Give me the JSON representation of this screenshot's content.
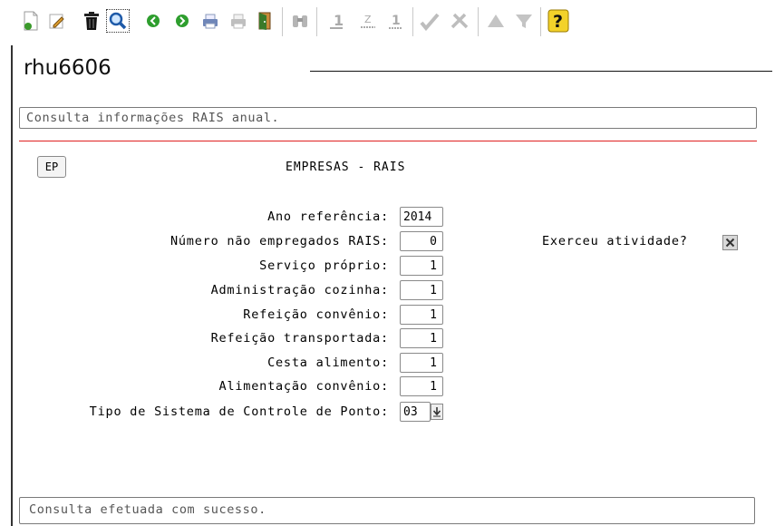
{
  "toolbar": {
    "buttons": [
      {
        "name": "new-document-icon"
      },
      {
        "name": "edit-pencil-icon"
      },
      {
        "name": "trash-icon"
      },
      {
        "name": "search-magnifier-icon"
      },
      {
        "name": "previous-record-icon"
      },
      {
        "name": "next-record-icon"
      },
      {
        "name": "print-icon"
      },
      {
        "name": "print-disabled-icon"
      },
      {
        "name": "exit-door-icon"
      },
      {
        "name": "binoculars-icon"
      },
      {
        "name": "first-record-icon"
      },
      {
        "name": "last-record-icon"
      },
      {
        "name": "confirm-check-icon"
      },
      {
        "name": "cancel-tools-icon"
      },
      {
        "name": "up-icon"
      },
      {
        "name": "filter-icon"
      },
      {
        "name": "help-question-icon"
      }
    ]
  },
  "program": {
    "name": "rhu6606",
    "description": "Consulta informações RAIS anual."
  },
  "frame": {
    "tag": "EP",
    "title": "EMPRESAS - RAIS"
  },
  "form": {
    "ano_referencia": {
      "label": "Ano referência:",
      "value": "2014"
    },
    "num_nao_empregados": {
      "label": "Número não empregados RAIS:",
      "value": "0"
    },
    "servico_proprio": {
      "label": "Serviço próprio:",
      "value": "1"
    },
    "administracao_cozinha": {
      "label": "Administração cozinha:",
      "value": "1"
    },
    "refeicao_convenio": {
      "label": "Refeição convênio:",
      "value": "1"
    },
    "refeicao_transportada": {
      "label": "Refeição transportada:",
      "value": "1"
    },
    "cesta_alimento": {
      "label": "Cesta alimento:",
      "value": "1"
    },
    "alimentacao_convenio": {
      "label": "Alimentação convênio:",
      "value": "1"
    },
    "tipo_sistema_ponto": {
      "label": "Tipo de Sistema de Controle de Ponto:",
      "value": "03"
    },
    "exerceu_atividade": {
      "label": "Exerceu atividade?",
      "checked": true
    }
  },
  "status": {
    "message": "Consulta efetuada com sucesso."
  }
}
